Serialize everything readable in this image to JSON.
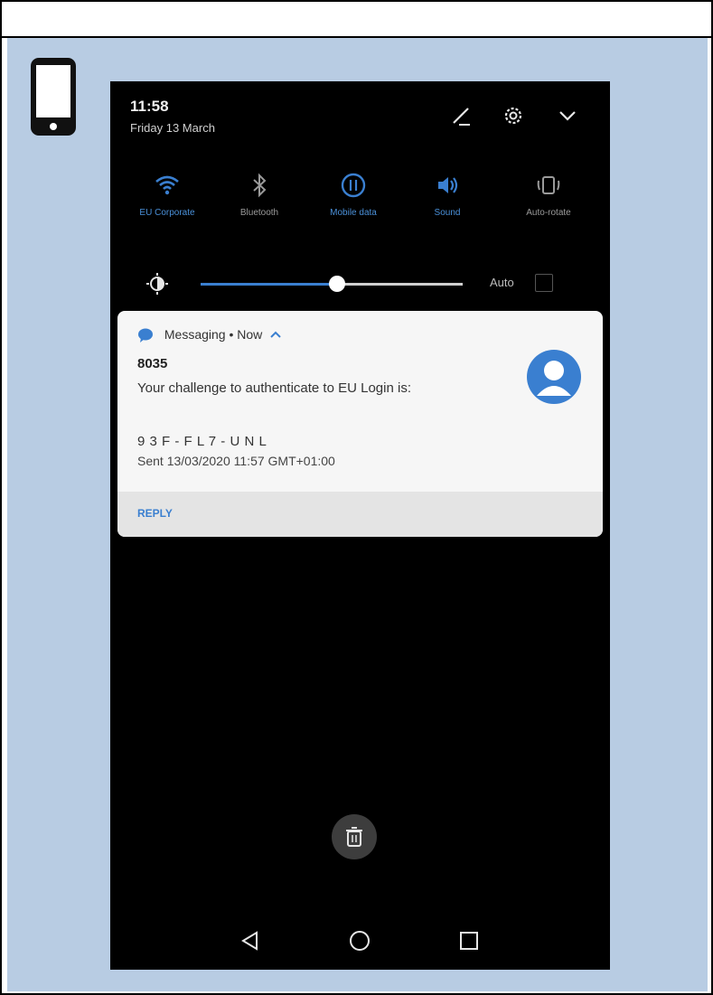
{
  "status": {
    "time": "11:58",
    "date": "Friday 13 March"
  },
  "top_icons": [
    "pencil-icon",
    "gear-icon",
    "chevron-down-icon"
  ],
  "quick_settings": [
    {
      "label": "EU Corporate",
      "icon": "wifi-icon",
      "state": "on"
    },
    {
      "label": "Bluetooth",
      "icon": "bluetooth-icon",
      "state": "off"
    },
    {
      "label": "Mobile data",
      "icon": "mobile-data-icon",
      "state": "on"
    },
    {
      "label": "Sound",
      "icon": "sound-icon",
      "state": "on"
    },
    {
      "label": "Auto-rotate",
      "icon": "auto-rotate-icon",
      "state": "off"
    }
  ],
  "brightness": {
    "level": 0.52,
    "auto_label": "Auto"
  },
  "notification": {
    "app": "Messaging",
    "time": "Now",
    "header": "Messaging • Now",
    "sender": "8035",
    "body": "Your challenge to authenticate to EU Login is:",
    "code": "9 3 F - F L 7 - U N L",
    "sent": "Sent 13/03/2020 11:57 GMT+01:00",
    "action": "REPLY"
  },
  "navigation": [
    "back-icon",
    "home-icon",
    "recents-icon"
  ],
  "colors": {
    "panel": "#b8cce3",
    "accent": "#3a7fd0",
    "screen": "#000000",
    "card": "#f6f6f6"
  }
}
